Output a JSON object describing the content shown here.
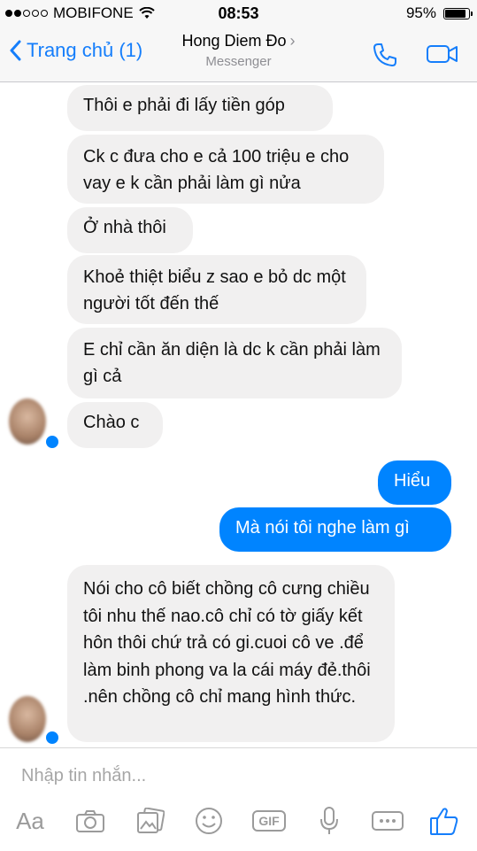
{
  "status": {
    "carrier": "MOBIFONE",
    "time": "08:53",
    "battery": "95%",
    "battery_level": 0.95,
    "signal_bars": 2
  },
  "header": {
    "back_label": "Trang chủ (1)",
    "contact_name": "Hong Diem Đo",
    "subtitle": "Messenger"
  },
  "colors": {
    "accent": "#157efb",
    "my_bubble": "#0084ff",
    "their_bubble": "#f1f0f0"
  },
  "messages": [
    {
      "from": "them",
      "text": "Thôi e phải đi lấy tiền góp"
    },
    {
      "from": "them",
      "text": "Ck c đưa cho e cả 100 triệu e cho vay e k cần phải làm gì nửa"
    },
    {
      "from": "them",
      "text": "Ở nhà thôi"
    },
    {
      "from": "them",
      "text": "Khoẻ thiệt biểu z sao e bỏ dc một người tốt đến thế"
    },
    {
      "from": "them",
      "text": "E chỉ cần ăn diện là dc k cần phải làm gì cả"
    },
    {
      "from": "them",
      "text": "Chào c"
    },
    {
      "from": "me",
      "text": "Hiểu"
    },
    {
      "from": "me",
      "text": "Mà nói tôi nghe làm gì"
    },
    {
      "from": "them",
      "text": "Nói cho cô biết chồng cô cưng chiều tôi nhu thế nao.cô chỉ có tờ giấy kết hôn thôi chứ trả có gi.cuoi cô ve .để làm binh phong va la cái máy đẻ.thôi .nên chồng cô chỉ mang hình thức."
    }
  ],
  "composer": {
    "placeholder": "Nhập tin nhắn...",
    "aa_label": "Aa",
    "gif_label": "GIF",
    "icons": [
      "text-size-icon",
      "camera-icon",
      "gallery-icon",
      "emoji-icon",
      "gif-icon",
      "microphone-icon",
      "more-icon",
      "thumbs-up-icon"
    ]
  }
}
